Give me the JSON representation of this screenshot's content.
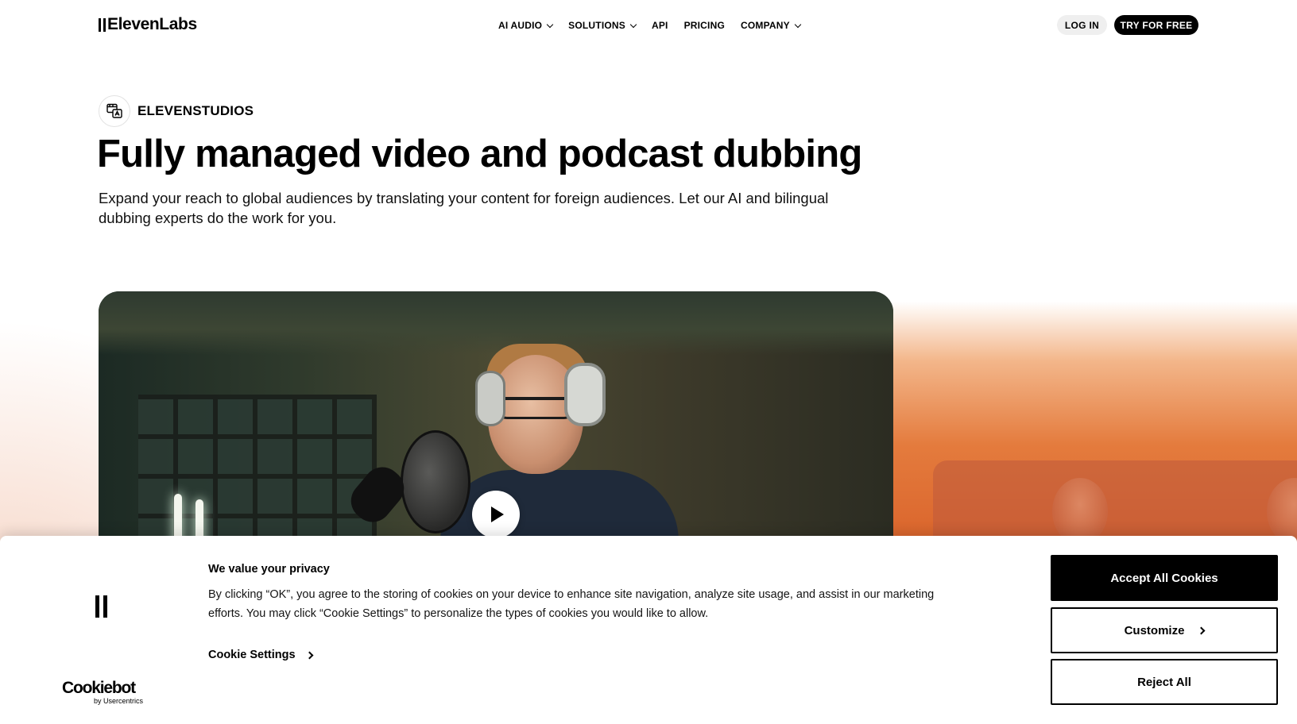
{
  "header": {
    "logo": "ElevenLabs",
    "nav": [
      {
        "label": "AI AUDIO",
        "dropdown": true
      },
      {
        "label": "SOLUTIONS",
        "dropdown": true
      },
      {
        "label": "API",
        "dropdown": false
      },
      {
        "label": "PRICING",
        "dropdown": false
      },
      {
        "label": "COMPANY",
        "dropdown": true
      }
    ],
    "login_label": "LOG IN",
    "try_label": "TRY FOR FREE"
  },
  "hero": {
    "badge": "ELEVENSTUDIOS",
    "title": "Fully managed video and podcast dubbing",
    "subtitle": "Expand your reach to global audiences by translating your content for foreign audiences. Let our AI and bilingual dubbing experts do the work for you."
  },
  "video": {
    "play_icon": "play-icon"
  },
  "cookie_banner": {
    "title": "We value your privacy",
    "text": "By clicking “OK”, you agree to the storing of cookies on your device to enhance site navigation, analyze site usage, and assist in our marketing efforts. You may click “Cookie Settings” to personalize the types of cookies you would like to allow.",
    "settings_label": "Cookie Settings",
    "accept_label": "Accept All Cookies",
    "customize_label": "Customize",
    "reject_label": "Reject All",
    "brand": "Cookiebot",
    "brand_sub": "by Usercentrics"
  },
  "colors": {
    "accent_orange": "#d9622a",
    "button_dark": "#000000"
  }
}
